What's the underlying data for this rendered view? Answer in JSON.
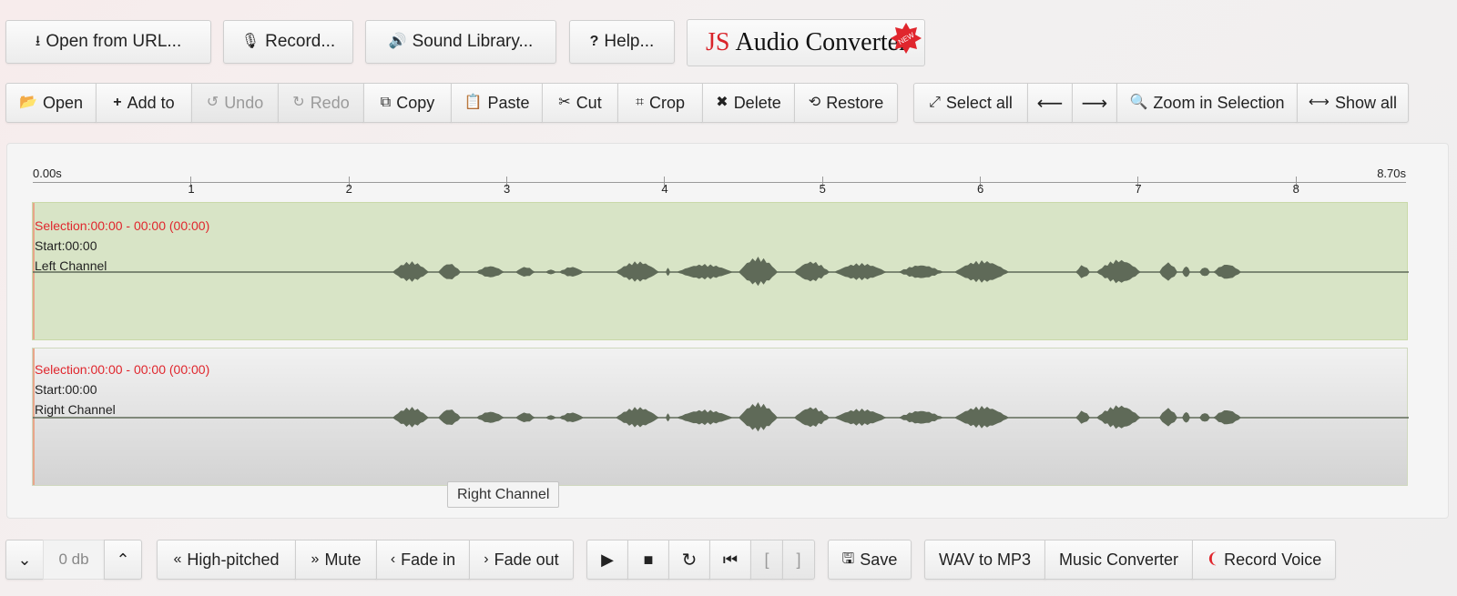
{
  "top_bar": {
    "open_url": "Open from URL...",
    "record": "Record...",
    "sound_library": "Sound Library...",
    "help": "Help...",
    "logo_js": "JS",
    "logo_rest": "Audio Converter",
    "logo_badge": "NEW"
  },
  "toolbar": {
    "open": "Open",
    "add_to": "Add to",
    "undo": "Undo",
    "redo": "Redo",
    "copy": "Copy",
    "paste": "Paste",
    "cut": "Cut",
    "crop": "Crop",
    "delete": "Delete",
    "restore": "Restore",
    "select_all": "Select all",
    "zoom_in_selection": "Zoom in Selection",
    "show_all": "Show all"
  },
  "timeline": {
    "start_label": "0.00s",
    "end_label": "8.70s",
    "ticks": [
      "1",
      "2",
      "3",
      "4",
      "5",
      "6",
      "7",
      "8"
    ]
  },
  "channels": {
    "left": {
      "selection": "Selection:00:00 - 00:00 (00:00)",
      "start": "Start:00:00",
      "name": "Left Channel"
    },
    "right": {
      "selection": "Selection:00:00 - 00:00 (00:00)",
      "start": "Start:00:00",
      "name": "Right Channel"
    }
  },
  "tooltip": "Right Channel",
  "bottom_bar": {
    "volume": "0 db",
    "high_pitched": "High-pitched",
    "mute": "Mute",
    "fade_in": "Fade in",
    "fade_out": "Fade out",
    "mark_start": "[",
    "mark_end": "]",
    "save": "Save",
    "wav_to_mp3": "WAV to MP3",
    "music_converter": "Music Converter",
    "record_voice": "Record Voice"
  },
  "colors": {
    "left_channel_bg": "#d8e4c6",
    "selection_text": "#e0262d",
    "waveform": "#5f6a58"
  }
}
